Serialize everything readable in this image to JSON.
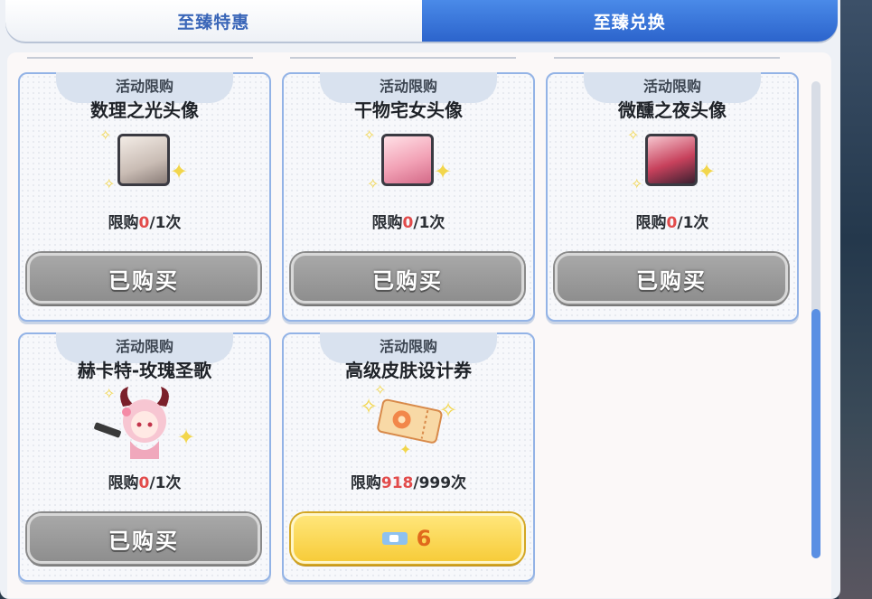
{
  "tabs": [
    {
      "label": "至臻特惠",
      "active": false
    },
    {
      "label": "至臻兑换",
      "active": true
    }
  ],
  "cards": [
    {
      "tag": "活动限购",
      "title": "数理之光头像",
      "limit_prefix": "限购",
      "limit_count": "0",
      "limit_suffix": "/1次",
      "button": "已购买",
      "status": "bought",
      "icon": "avatar-silver-hair"
    },
    {
      "tag": "活动限购",
      "title": "干物宅女头像",
      "limit_prefix": "限购",
      "limit_count": "0",
      "limit_suffix": "/1次",
      "button": "已购买",
      "status": "bought",
      "icon": "avatar-pink-hair-sleep-mask"
    },
    {
      "tag": "活动限购",
      "title": "微醺之夜头像",
      "limit_prefix": "限购",
      "limit_count": "0",
      "limit_suffix": "/1次",
      "button": "已购买",
      "status": "bought",
      "icon": "avatar-red-dress"
    },
    {
      "tag": "活动限购",
      "title": "赫卡特-玫瑰圣歌",
      "limit_prefix": "限购",
      "limit_count": "0",
      "limit_suffix": "/1次",
      "button": "已购买",
      "status": "bought",
      "icon": "skin-chibi-horns"
    },
    {
      "tag": "活动限购",
      "title": "高级皮肤设计券",
      "limit_prefix": "限购",
      "limit_count": "918",
      "limit_suffix": "/999次",
      "button": "6",
      "status": "available",
      "icon": "skin-design-ticket"
    }
  ],
  "currency_icon": "ticket-icon",
  "colors": {
    "accent_blue": "#2c64cc",
    "limit_red": "#e24b4b",
    "buy_yellow": "#f7cc3a",
    "bought_gray": "#8e8e8e"
  }
}
